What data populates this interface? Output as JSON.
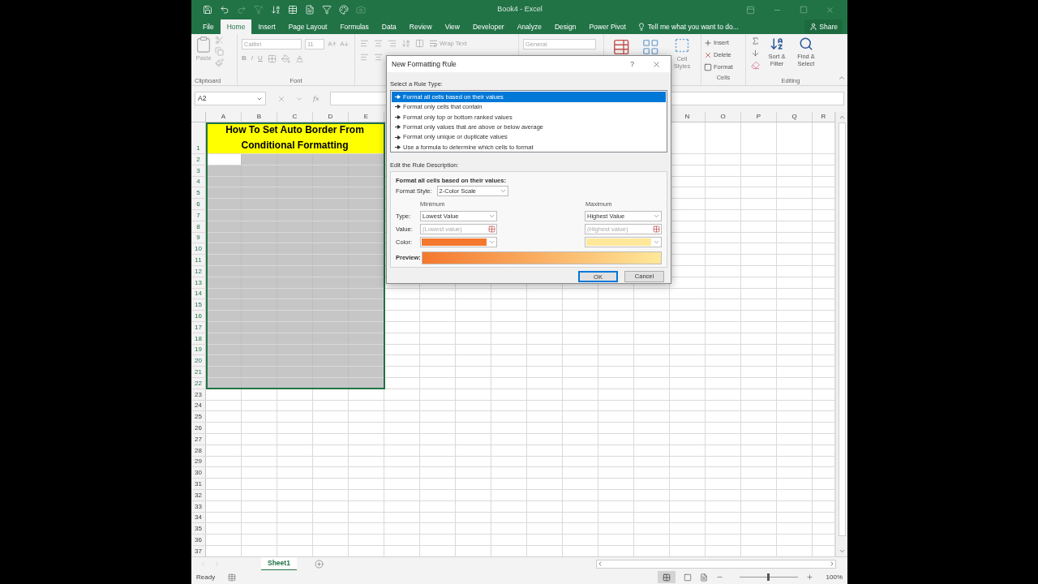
{
  "window": {
    "title": "Book4 - Excel"
  },
  "ribbon_tabs": [
    {
      "label": "File",
      "selected": false
    },
    {
      "label": "Home",
      "selected": true
    },
    {
      "label": "Insert",
      "selected": false
    },
    {
      "label": "Page Layout",
      "selected": false
    },
    {
      "label": "Formulas",
      "selected": false
    },
    {
      "label": "Data",
      "selected": false
    },
    {
      "label": "Review",
      "selected": false
    },
    {
      "label": "View",
      "selected": false
    },
    {
      "label": "Developer",
      "selected": false
    },
    {
      "label": "Analyze",
      "selected": false
    },
    {
      "label": "Design",
      "selected": false
    },
    {
      "label": "Power Pivot",
      "selected": false
    }
  ],
  "tell_me": {
    "placeholder": "Tell me what you want to do..."
  },
  "share": "Share",
  "ribbon": {
    "clipboard": {
      "paste": "Paste",
      "label": "Clipboard"
    },
    "font": {
      "name": "Calibri",
      "size": "11",
      "bold": "B",
      "italic": "I",
      "underline": "U",
      "label": "Font"
    },
    "alignment": {
      "wrap_text": "Wrap Text"
    },
    "number": {
      "format": "General"
    },
    "styles": {
      "cell_styles": "Cell Styles"
    },
    "cells": {
      "insert": "Insert",
      "delete": "Delete",
      "format": "Format",
      "label": "Cells"
    },
    "editing": {
      "sort_filter": "Sort & Filter",
      "find_select": "Find & Select",
      "label": "Editing"
    }
  },
  "formula_bar": {
    "name_box": "A2",
    "function": "fx"
  },
  "sheet": {
    "title": "How To Set Auto Border From Conditional Formatting",
    "columns": [
      "A",
      "B",
      "C",
      "D",
      "E",
      "N",
      "O",
      "P",
      "Q",
      "R"
    ],
    "rows": [
      {
        "number": "1",
        "selected": true,
        "active": false
      },
      {
        "number": "2",
        "selected": true,
        "active": true
      },
      {
        "number": "3",
        "selected": true,
        "active": false
      },
      {
        "number": "4",
        "selected": true,
        "active": false
      },
      {
        "number": "5",
        "selected": true,
        "active": false
      },
      {
        "number": "6",
        "selected": true,
        "active": false
      },
      {
        "number": "7",
        "selected": true,
        "active": false
      },
      {
        "number": "8",
        "selected": true,
        "active": false
      },
      {
        "number": "9",
        "selected": true,
        "active": false
      },
      {
        "number": "10",
        "selected": true,
        "active": false
      },
      {
        "number": "11",
        "selected": true,
        "active": false
      },
      {
        "number": "12",
        "selected": true,
        "active": false
      },
      {
        "number": "13",
        "selected": true,
        "active": false
      },
      {
        "number": "14",
        "selected": true,
        "active": false
      },
      {
        "number": "15",
        "selected": true,
        "active": false
      },
      {
        "number": "16",
        "selected": true,
        "active": false
      },
      {
        "number": "17",
        "selected": true,
        "active": false
      },
      {
        "number": "18",
        "selected": true,
        "active": false
      },
      {
        "number": "19",
        "selected": true,
        "active": false
      },
      {
        "number": "20",
        "selected": true,
        "active": false
      },
      {
        "number": "21",
        "selected": true,
        "active": false
      },
      {
        "number": "22",
        "selected": true,
        "active": false
      },
      {
        "number": "23",
        "selected": false,
        "active": false
      },
      {
        "number": "24",
        "selected": false,
        "active": false
      },
      {
        "number": "25",
        "selected": false,
        "active": false
      },
      {
        "number": "26",
        "selected": false,
        "active": false
      },
      {
        "number": "27",
        "selected": false,
        "active": false
      },
      {
        "number": "28",
        "selected": false,
        "active": false
      },
      {
        "number": "29",
        "selected": false,
        "active": false
      },
      {
        "number": "30",
        "selected": false,
        "active": false
      },
      {
        "number": "31",
        "selected": false,
        "active": false
      },
      {
        "number": "32",
        "selected": false,
        "active": false
      },
      {
        "number": "33",
        "selected": false,
        "active": false
      },
      {
        "number": "34",
        "selected": false,
        "active": false
      },
      {
        "number": "35",
        "selected": false,
        "active": false
      },
      {
        "number": "36",
        "selected": false,
        "active": false
      },
      {
        "number": "37",
        "selected": false,
        "active": false
      }
    ]
  },
  "sheet_tabs": [
    {
      "label": "Sheet1",
      "selected": true
    }
  ],
  "status_bar": {
    "status": "Ready",
    "zoom": "100%"
  },
  "dialog": {
    "title": "New Formatting Rule",
    "help": "?",
    "rule_type_label": "Select a Rule Type:",
    "rule_types": [
      {
        "label": "Format all cells based on their values",
        "selected": true
      },
      {
        "label": "Format only cells that contain",
        "selected": false
      },
      {
        "label": "Format only top or bottom ranked values",
        "selected": false
      },
      {
        "label": "Format only values that are above or below average",
        "selected": false
      },
      {
        "label": "Format only unique or duplicate values",
        "selected": false
      },
      {
        "label": "Use a formula to determine which cells to format",
        "selected": false
      }
    ],
    "description_label": "Edit the Rule Description:",
    "description_heading": "Format all cells based on their values:",
    "format_style": {
      "label": "Format Style:",
      "value": "2-Color Scale"
    },
    "row_labels": {
      "type": "Type:",
      "value": "Value:",
      "color_label": "Color:"
    },
    "minimum": {
      "heading": "Minimum",
      "type": "Lowest Value",
      "value_placeholder": "(Lowest value)",
      "color": "#f4782e"
    },
    "maximum": {
      "heading": "Maximum",
      "type": "Highest Value",
      "value_placeholder": "(Highest value)",
      "color": "#ffe89a"
    },
    "preview_label": "Preview:",
    "buttons": [
      {
        "label": "OK",
        "default": true
      },
      {
        "label": "Cancel",
        "default": false
      }
    ]
  }
}
